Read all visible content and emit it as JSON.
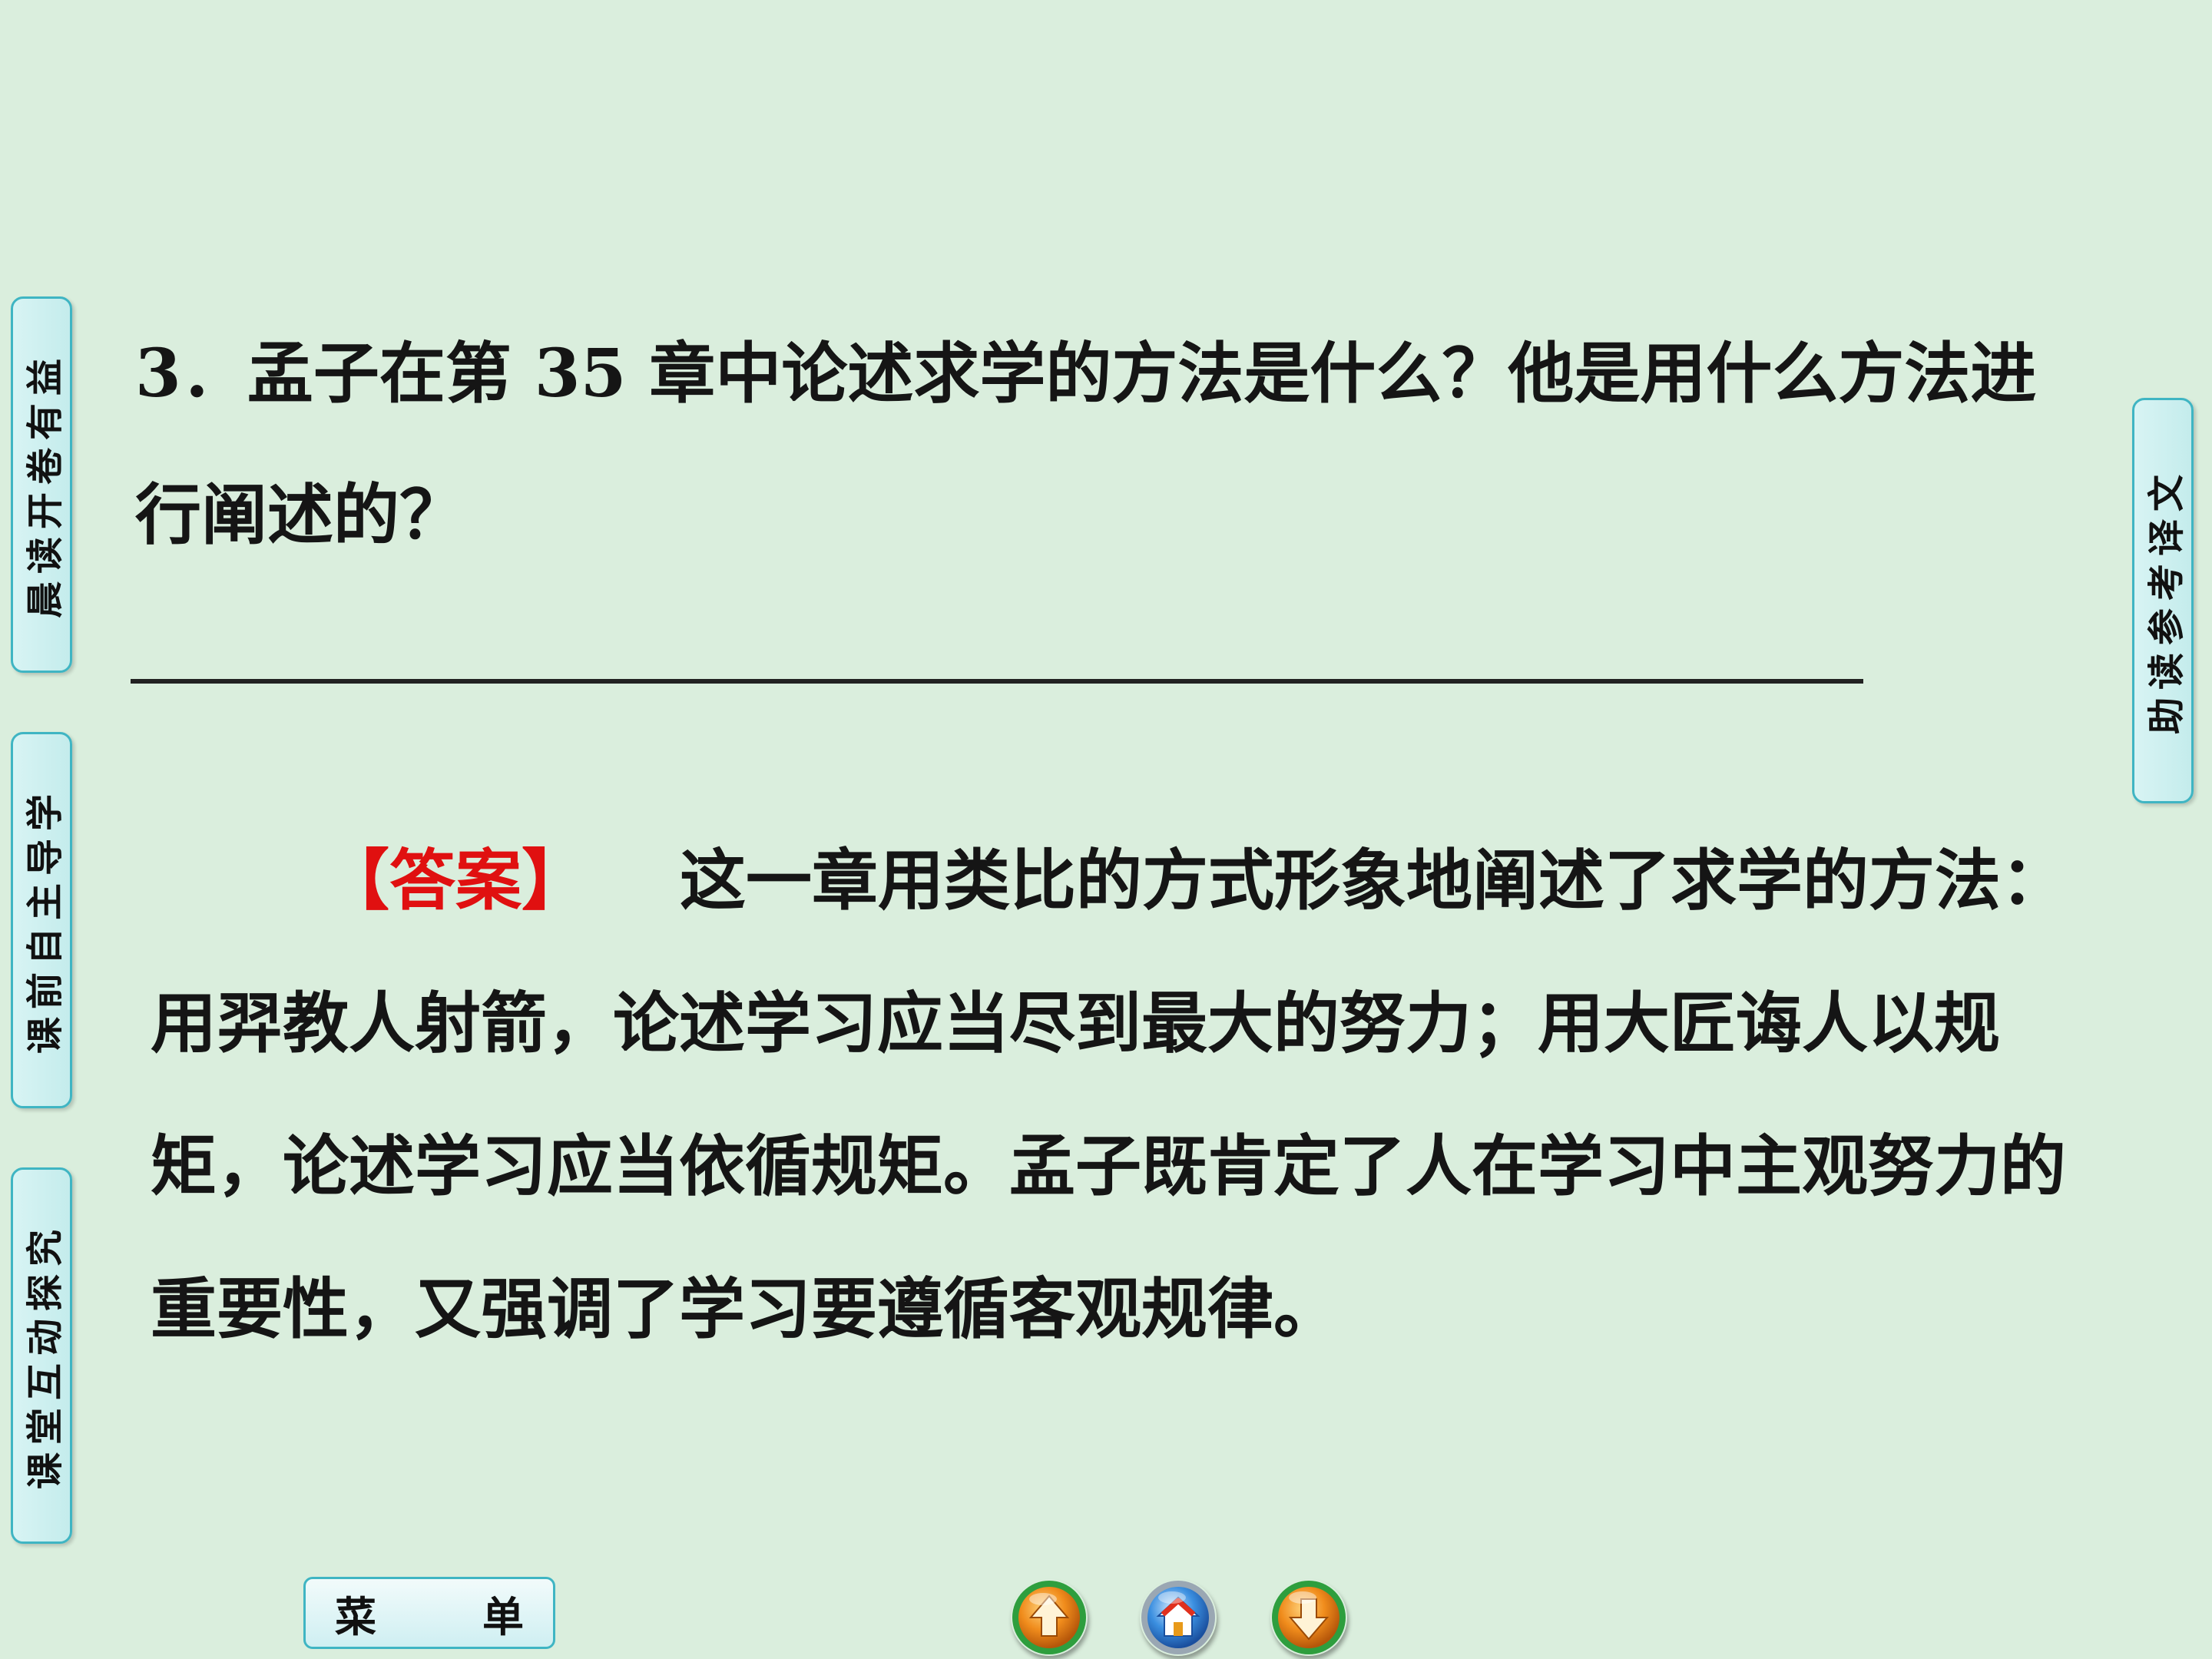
{
  "side_tabs": {
    "left": [
      "晨读开卷有益",
      "课前自主导学",
      "课堂互动探究"
    ],
    "right": [
      "助读参考译文"
    ]
  },
  "question": {
    "number": "3．",
    "text": "孟子在第 35 章中论述求学的方法是什么？他是用什么方法进行阐述的？"
  },
  "answer": {
    "label": "【答案】",
    "text": "这一章用类比的方式形象地阐述了求学的方法：用羿教人射箭，论述学习应当尽到最大的努力；用大匠诲人以规矩，论述学习应当依循规矩。孟子既肯定了人在学习中主观努力的重要性，又强调了学习要遵循客观规律。"
  },
  "bottom": {
    "menu_left": "菜",
    "menu_right": "单",
    "nav_icons": [
      "up-arrow-icon",
      "home-icon",
      "down-arrow-icon"
    ]
  },
  "colors": {
    "background": "#daeedd",
    "tab_border": "#3fb5c3",
    "answer_label": "#e01010"
  }
}
